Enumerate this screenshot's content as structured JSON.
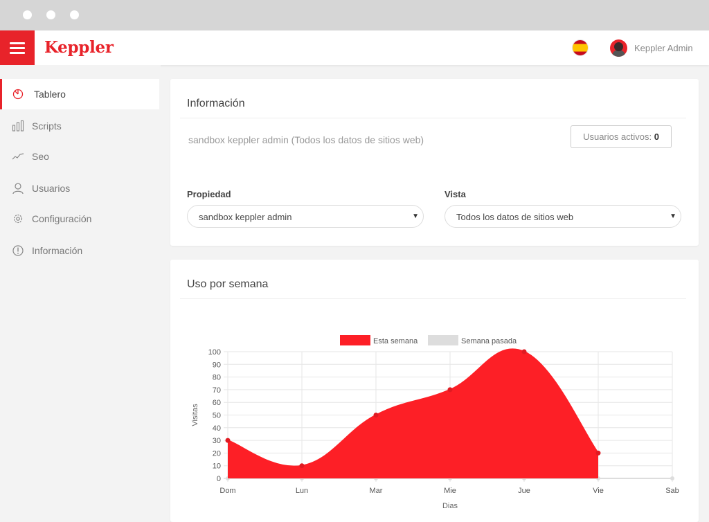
{
  "app": {
    "brand": "Keppler",
    "user_name": "Keppler Admin",
    "language_icon": "spain-flag-icon",
    "brand_color": "#e8232a"
  },
  "sidebar": {
    "items": [
      {
        "label": "Tablero",
        "icon": "dashboard-icon",
        "active": true
      },
      {
        "label": "Scripts",
        "icon": "bar-chart-icon",
        "active": false
      },
      {
        "label": "Seo",
        "icon": "trend-line-icon",
        "active": false
      },
      {
        "label": "Usuarios",
        "icon": "user-icon",
        "active": false
      },
      {
        "label": "Configuración",
        "icon": "gear-icon",
        "active": false
      },
      {
        "label": "Información",
        "icon": "info-icon",
        "active": false
      }
    ]
  },
  "info_card": {
    "title": "Información",
    "description": "sandbox keppler admin (Todos los datos de sitios web)",
    "active_users_label": "Usuarios activos:",
    "active_users_value": "0",
    "property_label": "Propiedad",
    "property_value": "sandbox keppler admin",
    "view_label": "Vista",
    "view_value": "Todos los datos de sitios web"
  },
  "usage_card": {
    "title": "Uso por semana"
  },
  "chart_data": {
    "type": "area",
    "categories": [
      "Dom",
      "Lun",
      "Mar",
      "Mie",
      "Jue",
      "Vie",
      "Sab"
    ],
    "xlabel": "Dias",
    "ylabel": "Visitas",
    "ylim": [
      0,
      100
    ],
    "yticks": [
      0,
      10,
      20,
      30,
      40,
      50,
      60,
      70,
      80,
      90,
      100
    ],
    "grid": true,
    "legend_position": "top-center",
    "series": [
      {
        "name": "Esta semana",
        "values": [
          30,
          10,
          50,
          70,
          100,
          20,
          null
        ],
        "color": "#fd1f26"
      },
      {
        "name": "Semana pasada",
        "values": [
          0,
          0,
          0,
          0,
          0,
          0,
          0
        ],
        "color": "#dddddd"
      }
    ]
  }
}
